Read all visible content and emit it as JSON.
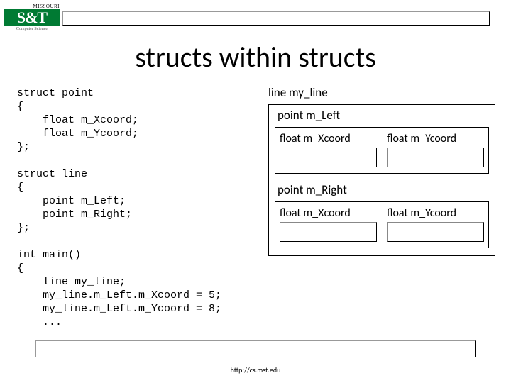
{
  "logo": {
    "university": "MISSOURI",
    "mark": "S&T",
    "dept": "Computer Science"
  },
  "title": "structs within structs",
  "code": "struct point\n{\n    float m_Xcoord;\n    float m_Ycoord;\n};\n\nstruct line\n{\n    point m_Left;\n    point m_Right;\n};\n\nint main()\n{\n    line my_line;\n    my_line.m_Left.m_Xcoord = 5;\n    my_line.m_Left.m_Ycoord = 8;\n    ...",
  "diagram": {
    "title": "line my_line",
    "left": {
      "title": "point m_Left",
      "x_label": "float m_Xcoord",
      "y_label": "float m_Ycoord"
    },
    "right": {
      "title": "point m_Right",
      "x_label": "float m_Xcoord",
      "y_label": "float m_Ycoord"
    }
  },
  "footer_url": "http://cs.mst.edu"
}
